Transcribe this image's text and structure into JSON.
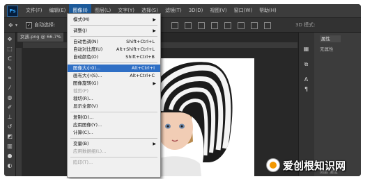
{
  "app": {
    "logo": "Ps"
  },
  "menubar": {
    "items": [
      "文件(F)",
      "编辑(E)",
      "图像(I)",
      "图层(L)",
      "文字(Y)",
      "选择(S)",
      "滤镜(T)",
      "3D(D)",
      "视图(V)",
      "窗口(W)",
      "帮助(H)"
    ],
    "active_index": 2
  },
  "options_bar": {
    "auto_select_label": "自动选择:",
    "mode_3d": "3D 模式:"
  },
  "document": {
    "tab_title": "女孩.png @ 66.7%"
  },
  "right_panel": {
    "tab": "属性",
    "subtitle": "无属性",
    "bottom": "图层  通道"
  },
  "image_menu": {
    "rows": [
      {
        "label": "模式(M)",
        "shortcut": "",
        "submenu": true,
        "disabled": false,
        "highlight": false
      },
      {
        "sep": true
      },
      {
        "label": "调整(J)",
        "shortcut": "",
        "submenu": true,
        "disabled": false,
        "highlight": false
      },
      {
        "sep": true
      },
      {
        "label": "自动色调(N)",
        "shortcut": "Shift+Ctrl+L",
        "submenu": false,
        "disabled": false,
        "highlight": false
      },
      {
        "label": "自动对比度(U)",
        "shortcut": "Alt+Shift+Ctrl+L",
        "submenu": false,
        "disabled": false,
        "highlight": false
      },
      {
        "label": "自动颜色(O)",
        "shortcut": "Shift+Ctrl+B",
        "submenu": false,
        "disabled": false,
        "highlight": false
      },
      {
        "sep": true
      },
      {
        "label": "图像大小(I)...",
        "shortcut": "Alt+Ctrl+I",
        "submenu": false,
        "disabled": false,
        "highlight": true
      },
      {
        "label": "画布大小(S)...",
        "shortcut": "Alt+Ctrl+C",
        "submenu": false,
        "disabled": false,
        "highlight": false
      },
      {
        "label": "图像旋转(G)",
        "shortcut": "",
        "submenu": true,
        "disabled": false,
        "highlight": false
      },
      {
        "label": "裁剪(P)",
        "shortcut": "",
        "submenu": false,
        "disabled": true,
        "highlight": false
      },
      {
        "label": "裁切(R)...",
        "shortcut": "",
        "submenu": false,
        "disabled": false,
        "highlight": false
      },
      {
        "label": "显示全部(V)",
        "shortcut": "",
        "submenu": false,
        "disabled": false,
        "highlight": false
      },
      {
        "sep": true
      },
      {
        "label": "复制(D)...",
        "shortcut": "",
        "submenu": false,
        "disabled": false,
        "highlight": false
      },
      {
        "label": "应用图像(Y)...",
        "shortcut": "",
        "submenu": false,
        "disabled": false,
        "highlight": false
      },
      {
        "label": "计算(C)...",
        "shortcut": "",
        "submenu": false,
        "disabled": false,
        "highlight": false
      },
      {
        "sep": true
      },
      {
        "label": "变量(B)",
        "shortcut": "",
        "submenu": true,
        "disabled": false,
        "highlight": false
      },
      {
        "label": "应用数据组(L)...",
        "shortcut": "",
        "submenu": false,
        "disabled": true,
        "highlight": false
      },
      {
        "sep": true
      },
      {
        "label": "陷印(T)...",
        "shortcut": "",
        "submenu": false,
        "disabled": true,
        "highlight": false
      }
    ]
  },
  "watermark": {
    "text": "爱创根知识网"
  },
  "colors": {
    "menu_highlight": "#2f6fc5",
    "ps_blue": "#31a8ff",
    "ui_dark": "#282828"
  }
}
